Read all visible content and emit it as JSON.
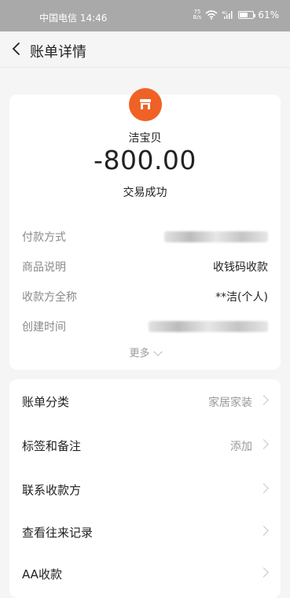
{
  "status_bar": {
    "carrier_time": "中国电信 14:46",
    "speed": "75\nB/s",
    "battery": "61%",
    "battery_level": 61
  },
  "header": {
    "title": "账单详情",
    "back_icon": "chevron-left-icon"
  },
  "summary": {
    "merchant_icon": "shop-icon",
    "merchant_name": "洁宝贝",
    "amount": "-800.00",
    "status": "交易成功",
    "details": [
      {
        "label": "付款方式",
        "value": ""
      },
      {
        "label": "商品说明",
        "value": "收钱码收款"
      },
      {
        "label": "收款方全称",
        "value": "**洁(个人)"
      },
      {
        "label": "创建时间",
        "value": ""
      }
    ],
    "more": "更多"
  },
  "menu": {
    "items": [
      {
        "label": "账单分类",
        "value": "家居家装"
      },
      {
        "label": "标签和备注",
        "value": "添加"
      },
      {
        "label": "联系收款方",
        "value": ""
      },
      {
        "label": "查看往来记录",
        "value": ""
      },
      {
        "label": "AA收款",
        "value": ""
      }
    ]
  },
  "colors": {
    "status_bar": "#a9a9a9",
    "accent": "#f06126"
  }
}
